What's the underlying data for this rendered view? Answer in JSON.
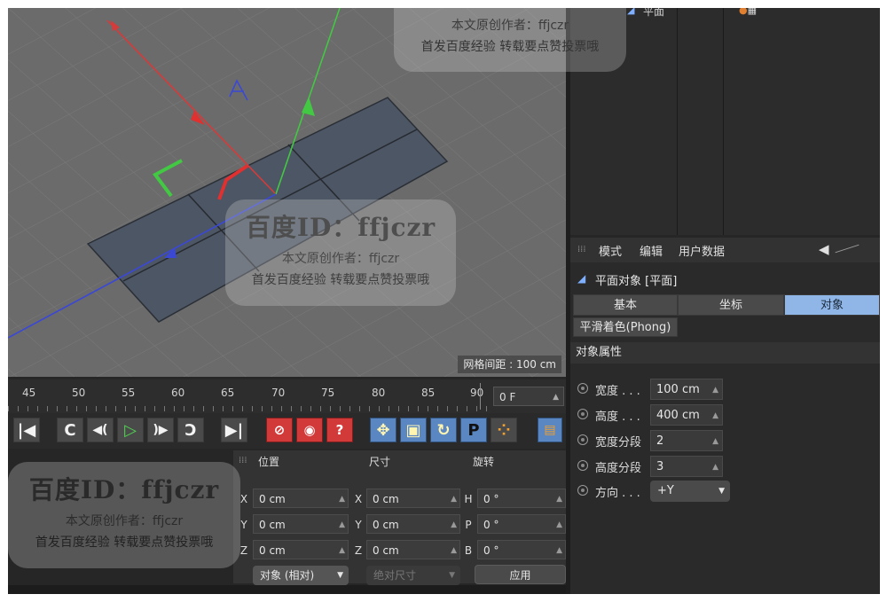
{
  "viewport": {
    "grid_spacing_label": "网格间距 : 100 cm",
    "colors": {
      "background": "#6b6b6b",
      "plane": "#4d5664",
      "axis_x": "#d43b3b",
      "axis_y": "#43c843",
      "axis_z": "#3b48d4"
    }
  },
  "timeline": {
    "ticks": [
      "45",
      "50",
      "55",
      "60",
      "65",
      "70",
      "75",
      "80",
      "85",
      "90"
    ],
    "current_frame": "0 F"
  },
  "transport": {
    "buttons": [
      {
        "name": "goto-start-button",
        "glyph": "|◀"
      },
      {
        "name": "prev-key-button",
        "glyph": "C"
      },
      {
        "name": "prev-frame-button",
        "glyph": "◀("
      },
      {
        "name": "play-button",
        "glyph": "▷"
      },
      {
        "name": "next-frame-button",
        "glyph": ")▶"
      },
      {
        "name": "next-key-button",
        "glyph": "Ɔ"
      },
      {
        "name": "goto-end-button",
        "glyph": "▶|"
      }
    ],
    "record_buttons": [
      {
        "name": "record-keys-button",
        "glyph": "⊘"
      },
      {
        "name": "autokey-button",
        "glyph": "◉"
      },
      {
        "name": "key-help-button",
        "glyph": "?"
      }
    ],
    "mode_buttons": [
      {
        "name": "move-key-button",
        "glyph": "✥"
      },
      {
        "name": "scale-key-button",
        "glyph": "▣"
      },
      {
        "name": "rotate-key-button",
        "glyph": "↻"
      },
      {
        "name": "param-key-button",
        "glyph": "P"
      },
      {
        "name": "point-level-button",
        "glyph": "⁘"
      }
    ]
  },
  "coords": {
    "headers": {
      "position": "位置",
      "size": "尺寸",
      "rotation": "旋转"
    },
    "rows": [
      {
        "pos_axis": "X",
        "pos": "0 cm",
        "size_axis": "X",
        "size": "0 cm",
        "rot_axis": "H",
        "rot": "0 °"
      },
      {
        "pos_axis": "Y",
        "pos": "0 cm",
        "size_axis": "Y",
        "size": "0 cm",
        "rot_axis": "P",
        "rot": "0 °"
      },
      {
        "pos_axis": "Z",
        "pos": "0 cm",
        "size_axis": "Z",
        "size": "0 cm",
        "rot_axis": "B",
        "rot": "0 °"
      }
    ],
    "mode_dropdown": "对象 (相对)",
    "size_dropdown": "绝对尺寸",
    "apply_label": "应用"
  },
  "object_manager": {
    "item_label": "平面"
  },
  "attributes": {
    "menu": {
      "mode": "模式",
      "edit": "编辑",
      "user_data": "用户数据"
    },
    "object_title": "平面对象 [平面]",
    "tabs": [
      {
        "label": "基本",
        "active": false
      },
      {
        "label": "坐标",
        "active": false
      },
      {
        "label": "对象",
        "active": true
      }
    ],
    "phong_tab": "平滑着色(Phong)",
    "section": "对象属性",
    "properties": [
      {
        "label": "宽度 . . .",
        "value": "100 cm"
      },
      {
        "label": "高度 . . .",
        "value": "400 cm"
      },
      {
        "label": "宽度分段",
        "value": "2"
      },
      {
        "label": "高度分段",
        "value": "3"
      }
    ],
    "orientation": {
      "label": "方向 . . .",
      "value": "+Y"
    }
  },
  "watermark": {
    "id": "百度ID：ffjczr",
    "author": "本文原创作者：ffjczr",
    "slogan": "首发百度经验 转载要点赞投票哦"
  }
}
